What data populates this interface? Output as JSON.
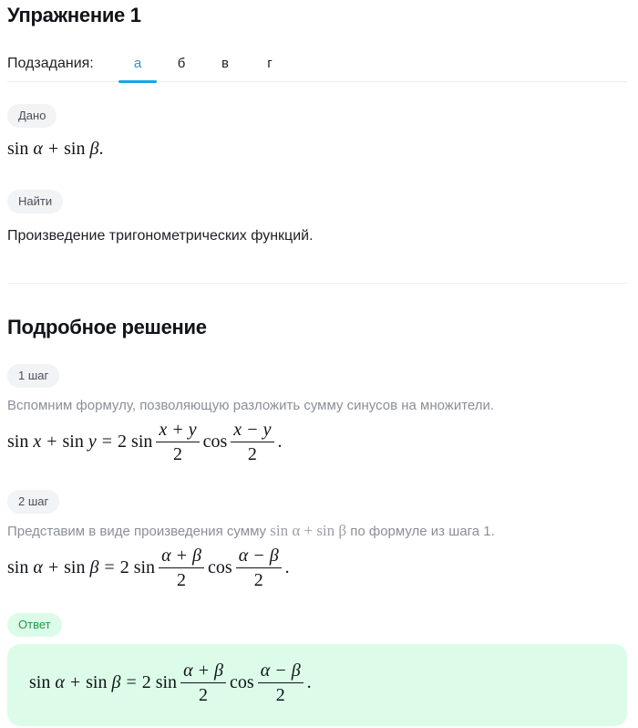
{
  "header": {
    "title": "Упражнение 1"
  },
  "subtasks": {
    "label": "Подзадания:",
    "tabs": [
      {
        "label": "а",
        "active": true
      },
      {
        "label": "б",
        "active": false
      },
      {
        "label": "в",
        "active": false
      },
      {
        "label": "г",
        "active": false
      }
    ],
    "accent_color": "#1aa3e8"
  },
  "given": {
    "badge": "Дано",
    "expression": {
      "f1": "sin",
      "v1": "α",
      "op": "+",
      "f2": "sin",
      "v2": "β",
      "end": "."
    }
  },
  "find": {
    "badge": "Найти",
    "text": "Произведение тригонометрических функций."
  },
  "solution": {
    "title": "Подробное решение",
    "steps": [
      {
        "badge": "1 шаг",
        "text": "Вспомним формулу, позволяющую разложить сумму синусов на множители.",
        "formula": {
          "lhs_f1": "sin",
          "lhs_v1": "x",
          "plus": "+",
          "lhs_f2": "sin",
          "lhs_v2": "y",
          "eq": "=",
          "coef": "2",
          "f3": "sin",
          "num1": "x + y",
          "den1": "2",
          "f4": "cos",
          "num2": "x − y",
          "den2": "2",
          "end": "."
        }
      },
      {
        "badge": "2 шаг",
        "text_before": "Представим в виде произведения сумму",
        "inline_math": "sin α + sin β",
        "text_after": "по формуле из шага 1.",
        "formula": {
          "lhs_f1": "sin",
          "lhs_v1": "α",
          "plus": "+",
          "lhs_f2": "sin",
          "lhs_v2": "β",
          "eq": "=",
          "coef": "2",
          "f3": "sin",
          "num1": "α + β",
          "den1": "2",
          "f4": "cos",
          "num2": "α − β",
          "den2": "2",
          "end": "."
        }
      }
    ],
    "answer": {
      "badge": "Ответ",
      "formula": {
        "lhs_f1": "sin",
        "lhs_v1": "α",
        "plus": "+",
        "lhs_f2": "sin",
        "lhs_v2": "β",
        "eq": "=",
        "coef": "2",
        "f3": "sin",
        "num1": "α + β",
        "den1": "2",
        "f4": "cos",
        "num2": "α − β",
        "den2": "2",
        "end": "."
      },
      "background_color": "#dcfce9"
    }
  }
}
